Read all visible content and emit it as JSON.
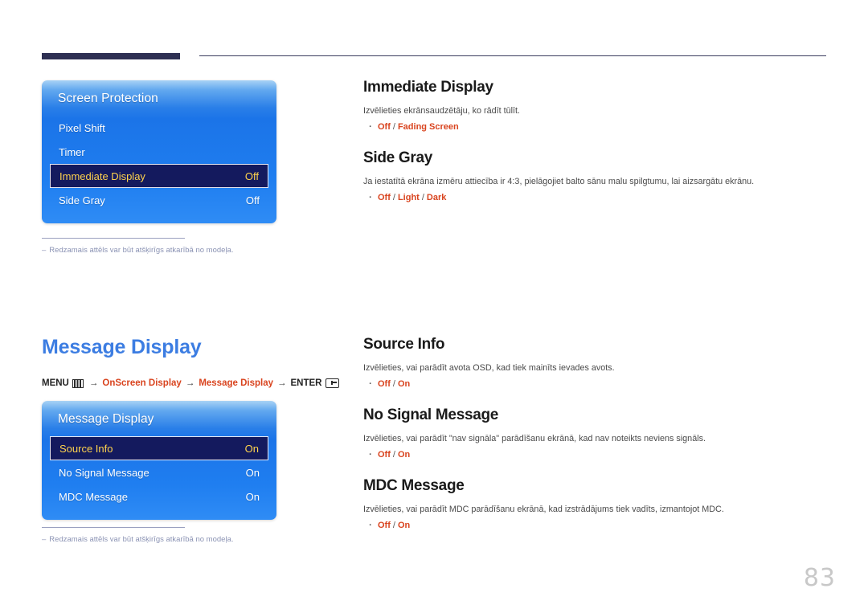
{
  "page": {
    "number": "83"
  },
  "header": {
    "bar_color": "#2e3053",
    "rule_color": "#3a3c5e"
  },
  "osd_panels": [
    {
      "title": "Screen Protection",
      "rows": [
        {
          "label": "Pixel Shift",
          "value": "",
          "selected": false
        },
        {
          "label": "Timer",
          "value": "",
          "selected": false
        },
        {
          "label": "Immediate Display",
          "value": "Off",
          "selected": true
        },
        {
          "label": "Side Gray",
          "value": "Off",
          "selected": false
        }
      ]
    },
    {
      "title": "Message Display",
      "rows": [
        {
          "label": "Source Info",
          "value": "On",
          "selected": true
        },
        {
          "label": "No Signal Message",
          "value": "On",
          "selected": false
        },
        {
          "label": "MDC Message",
          "value": "On",
          "selected": false
        }
      ]
    }
  ],
  "footnotes": [
    {
      "dash": "–",
      "text": "Redzamais attēls var būt atšķirīgs atkarībā no modeļa."
    },
    {
      "dash": "–",
      "text": "Redzamais attēls var būt atšķirīgs atkarībā no modeļa."
    }
  ],
  "section": {
    "title": "Message Display",
    "title_color": "#3c7de2"
  },
  "breadcrumb": {
    "menu_label": "MENU",
    "menu_icon": "menu-grid-icon",
    "arrow": "→",
    "step1": "OnScreen Display",
    "step2": "Message Display",
    "enter_label": "ENTER",
    "enter_icon": "enter-key-icon",
    "accent_color": "#d9441f"
  },
  "entries": [
    {
      "title": "Immediate Display",
      "desc": "Izvēlieties ekrānsaudzētāju, ko rādīt tūlīt.",
      "options": [
        "Off",
        "Fading Screen"
      ],
      "separator": "/"
    },
    {
      "title": "Side Gray",
      "desc": "Ja iestatītā ekrāna izmēru attiecība ir 4:3, pielāgojiet balto sānu malu spilgtumu, lai aizsargātu ekrānu.",
      "options": [
        "Off",
        "Light",
        "Dark"
      ],
      "separator": "/"
    },
    {
      "title": "Source Info",
      "desc": "Izvēlieties, vai parādīt avota OSD, kad tiek mainīts ievades avots.",
      "options": [
        "Off",
        "On"
      ],
      "separator": "/"
    },
    {
      "title": "No Signal Message",
      "desc": "Izvēlieties, vai parādīt \"nav signāla\" parādīšanu ekrānā, kad nav noteikts neviens signāls.",
      "options": [
        "Off",
        "On"
      ],
      "separator": "/"
    },
    {
      "title": "MDC Message",
      "desc": "Izvēlieties, vai parādīt MDC parādīšanu ekrānā, kad izstrādājums tiek vadīts, izmantojot MDC.",
      "options": [
        "Off",
        "On"
      ],
      "separator": "/"
    }
  ],
  "bullet": "·"
}
